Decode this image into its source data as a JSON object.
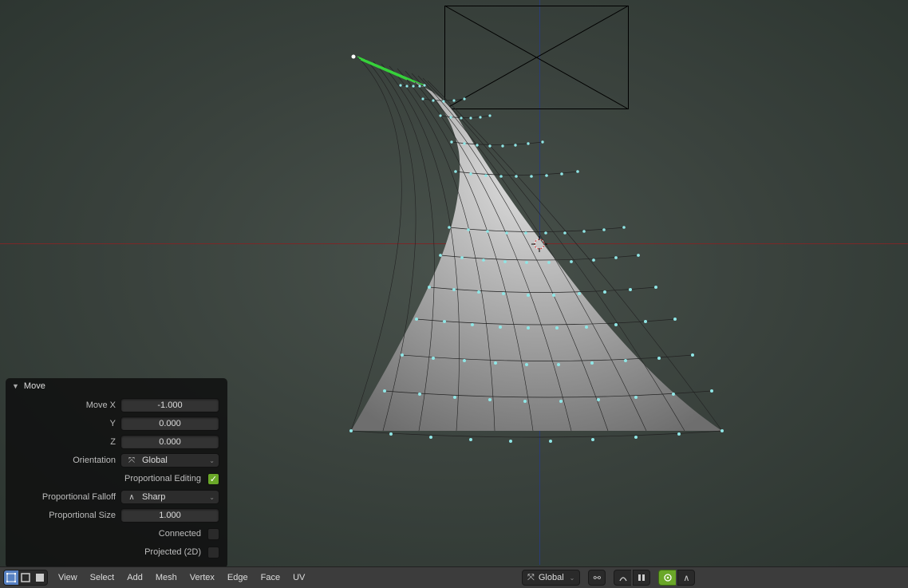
{
  "op_panel": {
    "title": "Move",
    "move_x_label": "Move X",
    "move_x_value": "-1.000",
    "move_y_label": "Y",
    "move_y_value": "0.000",
    "move_z_label": "Z",
    "move_z_value": "0.000",
    "orientation_label": "Orientation",
    "orientation_value": "Global",
    "prop_edit_label": "Proportional Editing",
    "prop_edit_checked": true,
    "falloff_label": "Proportional Falloff",
    "falloff_value": "Sharp",
    "size_label": "Proportional Size",
    "size_value": "1.000",
    "connected_label": "Connected",
    "connected_checked": false,
    "projected_label": "Projected (2D)",
    "projected_checked": false
  },
  "header": {
    "menus": [
      "View",
      "Select",
      "Add",
      "Mesh",
      "Vertex",
      "Edge",
      "Face",
      "UV"
    ],
    "orientation_value": "Global"
  },
  "icons": {
    "orientation": "⤧",
    "falloff": "∧",
    "check": "✓",
    "link": "⚯",
    "axes": "⤧",
    "chev": "⌄"
  }
}
